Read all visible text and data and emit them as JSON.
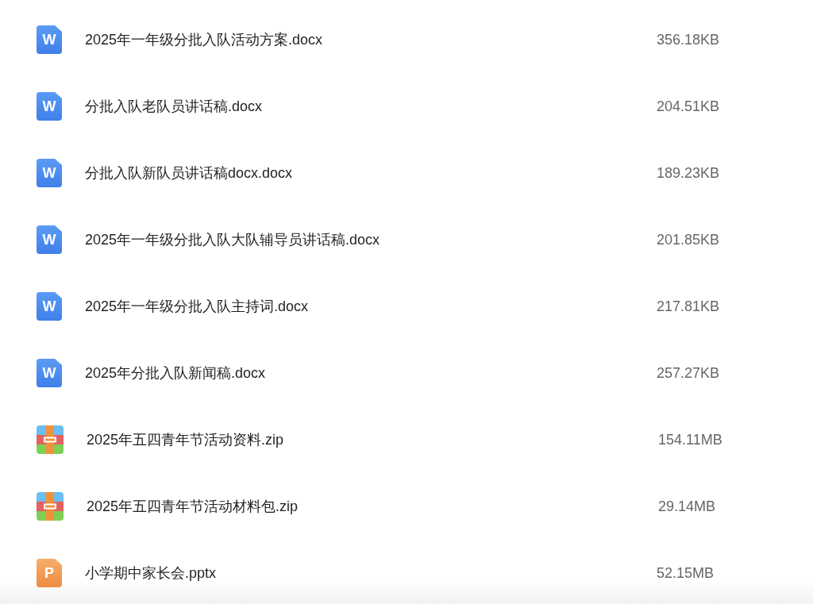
{
  "files": [
    {
      "kind": "doc",
      "icon_letter": "W",
      "name": "2025年一年级分批入队活动方案.docx",
      "size": "356.18KB"
    },
    {
      "kind": "doc",
      "icon_letter": "W",
      "name": "分批入队老队员讲话稿.docx",
      "size": "204.51KB"
    },
    {
      "kind": "doc",
      "icon_letter": "W",
      "name": "分批入队新队员讲话稿docx.docx",
      "size": "189.23KB"
    },
    {
      "kind": "doc",
      "icon_letter": "W",
      "name": "2025年一年级分批入队大队辅导员讲话稿.docx",
      "size": "201.85KB"
    },
    {
      "kind": "doc",
      "icon_letter": "W",
      "name": "2025年一年级分批入队主持词.docx",
      "size": "217.81KB"
    },
    {
      "kind": "doc",
      "icon_letter": "W",
      "name": "2025年分批入队新闻稿.docx",
      "size": "257.27KB"
    },
    {
      "kind": "zip",
      "name": "2025年五四青年节活动资料.zip",
      "size": "154.11MB"
    },
    {
      "kind": "zip",
      "name": "2025年五四青年节活动材料包.zip",
      "size": "29.14MB"
    },
    {
      "kind": "ppt",
      "icon_letter": "P",
      "name": "小学期中家长会.pptx",
      "size": "52.15MB"
    }
  ]
}
